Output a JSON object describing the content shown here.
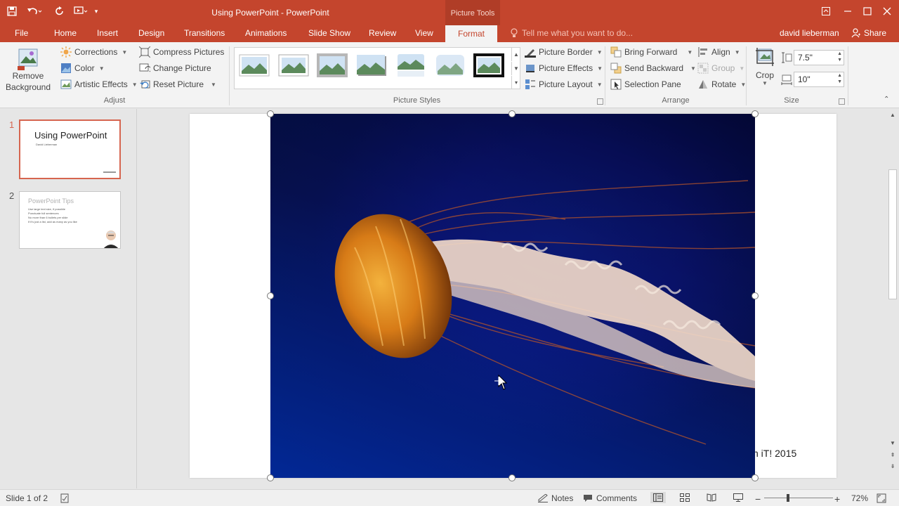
{
  "window": {
    "title": "Using PowerPoint - PowerPoint",
    "contextual_tab_title": "Picture Tools"
  },
  "tabs": [
    {
      "label": "File"
    },
    {
      "label": "Home"
    },
    {
      "label": "Insert"
    },
    {
      "label": "Design"
    },
    {
      "label": "Transitions"
    },
    {
      "label": "Animations"
    },
    {
      "label": "Slide Show"
    },
    {
      "label": "Review"
    },
    {
      "label": "View"
    },
    {
      "label": "Format",
      "active": true
    }
  ],
  "tell_me": {
    "placeholder": "Tell me what you want to do..."
  },
  "user": {
    "name": "david lieberman",
    "share_label": "Share"
  },
  "ribbon": {
    "adjust": {
      "label": "Adjust",
      "remove_background_line1": "Remove",
      "remove_background_line2": "Background",
      "corrections": "Corrections",
      "color": "Color",
      "artistic_effects": "Artistic Effects",
      "compress_pictures": "Compress Pictures",
      "change_picture": "Change Picture",
      "reset_picture": "Reset Picture"
    },
    "picture_styles": {
      "label": "Picture Styles",
      "picture_border": "Picture Border",
      "picture_effects": "Picture Effects",
      "picture_layout": "Picture Layout",
      "thumbnail_count": 7
    },
    "arrange": {
      "label": "Arrange",
      "bring_forward": "Bring Forward",
      "send_backward": "Send Backward",
      "selection_pane": "Selection Pane",
      "align": "Align",
      "group": "Group",
      "rotate": "Rotate"
    },
    "size": {
      "label": "Size",
      "crop": "Crop",
      "height": "7.5\"",
      "width": "10\""
    }
  },
  "slides": [
    {
      "number": "1",
      "title": "Using PowerPoint",
      "subtitle": "David Lieberman",
      "selected": true
    },
    {
      "number": "2",
      "title": "PowerPoint Tips",
      "bullets": [
        "Use large text size, if possible",
        "Punctuate full sentences",
        "No more than 6 bullets per slide",
        "If it's just a list, add as many as you like"
      ]
    }
  ],
  "slide_view": {
    "footer_text": "h iT! 2015"
  },
  "status": {
    "slide_indicator": "Slide 1 of 2",
    "notes": "Notes",
    "comments": "Comments",
    "zoom": "72%",
    "zoom_level_percent": 72
  },
  "colors": {
    "accent": "#c4452d",
    "ribbon_bg": "#f3f3f3",
    "selected_thumb_border": "#d6654f"
  }
}
